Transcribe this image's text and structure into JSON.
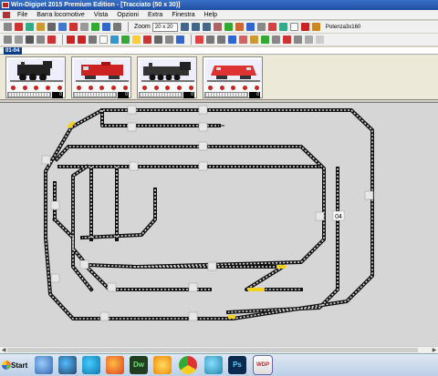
{
  "window": {
    "title": "Win-Digipet 2015 Premium Edition - [Tracciato (50 x 30)]"
  },
  "menu": [
    "File",
    "Barra locomotive",
    "Vista",
    "Opzioni",
    "Extra",
    "Finestra",
    "Help"
  ],
  "toolbar": {
    "zoom_label": "Zoom",
    "zoom_value": "20 x 20",
    "power_label": "Potenza3x160",
    "accent": "#1f4fa3"
  },
  "loco_bar": {
    "tab_label": "01-04",
    "locos": [
      {
        "name": "steam-loco-black",
        "speed": "0",
        "color": "#333"
      },
      {
        "name": "diesel-loco-red",
        "speed": "0",
        "color": "#c22"
      },
      {
        "name": "steam-loco-dark",
        "speed": "0",
        "color": "#555"
      },
      {
        "name": "diesel-loco-red-2",
        "speed": "0",
        "color": "#d33"
      }
    ]
  },
  "track": {
    "label_04": "04"
  },
  "taskbar": {
    "start_label": "Start",
    "apps": [
      "inkscape-icon",
      "thunderbird-icon",
      "edge-icon",
      "firefox-icon",
      "dreamweaver-icon",
      "settings-icon",
      "chrome-icon",
      "swallow-icon",
      "photoshop-icon",
      "wdp-icon"
    ],
    "wdp_label": "WDP"
  }
}
